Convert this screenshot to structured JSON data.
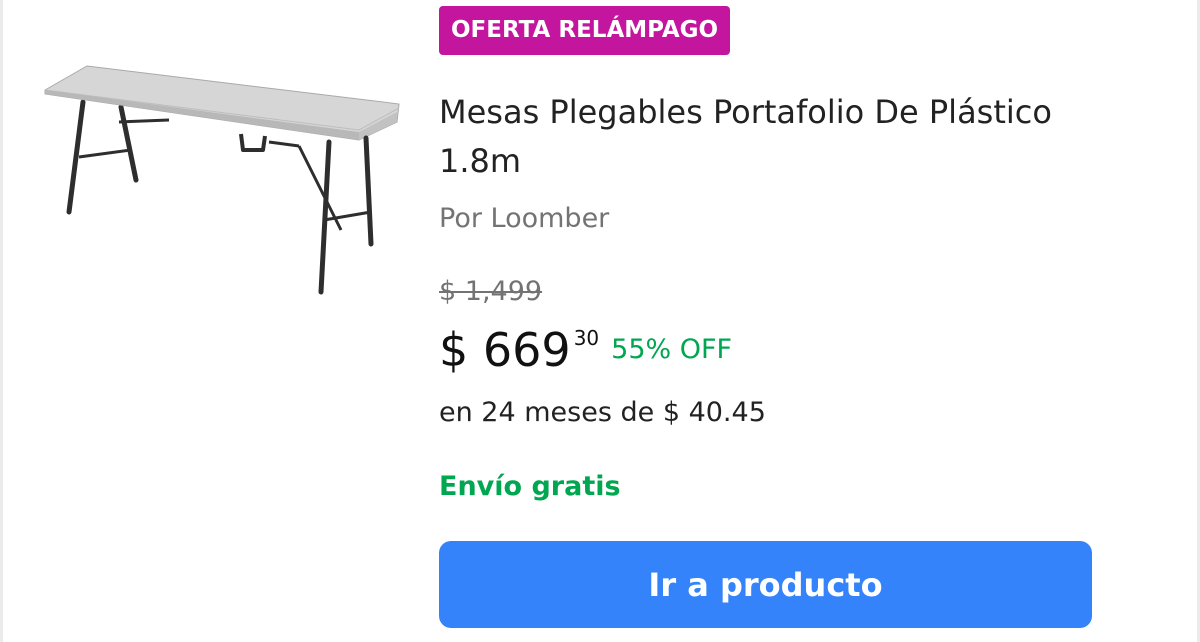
{
  "product": {
    "badge": "OFERTA RELÁMPAGO",
    "title": "Mesas Plegables Portafolio De Plástico 1.8m",
    "seller": "Por Loomber",
    "old_price": "$ 1,499",
    "price_main": "$ 669",
    "price_cents": "30",
    "discount": "55% OFF",
    "installments": "en 24 meses de $ 40.45",
    "shipping": "Envío gratis",
    "cta_label": "Ir a producto"
  },
  "colors": {
    "badge_bg": "#c4159f",
    "accent_green": "#00a650",
    "button_blue": "#3483fa"
  }
}
